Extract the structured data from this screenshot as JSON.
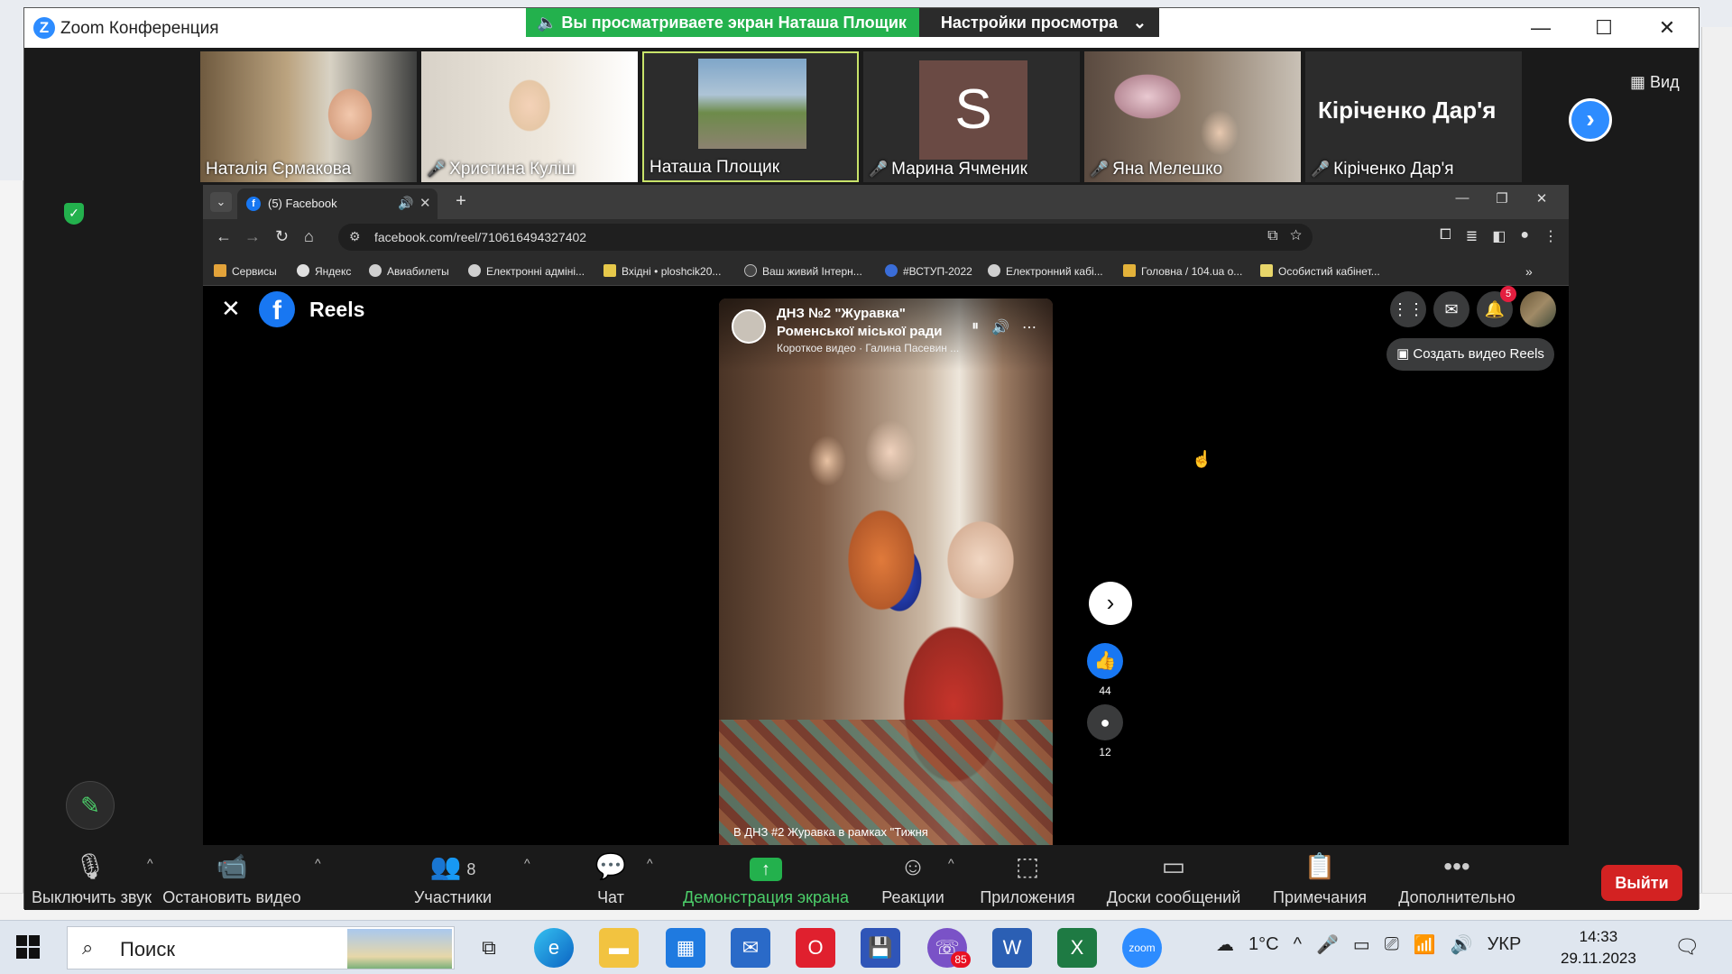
{
  "zoom": {
    "title": "Zoom Конференция",
    "share_banner": "Вы просматриваете экран Наташа Площик",
    "view_settings": "Настройки просмотра",
    "view_button": "Вид",
    "participants": [
      {
        "name": "Наталія Єрмакова",
        "muted": false
      },
      {
        "name": "Христина Куліш",
        "muted": true
      },
      {
        "name": "Наташа Площик",
        "muted": false
      },
      {
        "name": "Марина Ячменик",
        "muted": true,
        "avatar_letter": "S"
      },
      {
        "name": "Яна Мелешко",
        "muted": true
      },
      {
        "name": "Кіріченко Дар'я",
        "muted": true,
        "display_name": "Кіріченко Дар'я"
      }
    ],
    "toolbar": {
      "mute": "Выключить звук",
      "video": "Остановить видео",
      "participants": "Участники",
      "participants_count": "8",
      "chat": "Чат",
      "share": "Демонстрация экрана",
      "reactions": "Реакции",
      "apps": "Приложения",
      "whiteboards": "Доски сообщений",
      "notes": "Примечания",
      "more": "Дополнительно",
      "leave": "Выйти"
    }
  },
  "browser": {
    "tab_title": "(5) Facebook",
    "url": "facebook.com/reel/710616494327402",
    "bookmarks": [
      "Сервисы",
      "Яндекс",
      "Авиабилеты",
      "Електронні адміні...",
      "Вхідні • ploshcik20...",
      "Ваш живий Інтерн...",
      "#ВСТУП-2022",
      "Електронний кабі...",
      "Головна / 104.ua о...",
      "Особистий кабінет..."
    ]
  },
  "facebook": {
    "reels_title": "Reels",
    "notification_count": "5",
    "create_reel": "Создать видео Reels",
    "reel": {
      "author_line1": "ДНЗ №2 \"Журавка\"",
      "author_line2": "Роменської міської ради",
      "subtitle": "Короткое видео · Галина Пасевин ...",
      "caption": "В ДНЗ #2 Журавка в рамках \"Тижня",
      "likes": "44",
      "comments": "12"
    }
  },
  "taskbar": {
    "search_placeholder": "Поиск",
    "weather": "1°C",
    "language": "УКР",
    "time": "14:33",
    "date": "29.11.2023",
    "viber_badge": "85"
  }
}
